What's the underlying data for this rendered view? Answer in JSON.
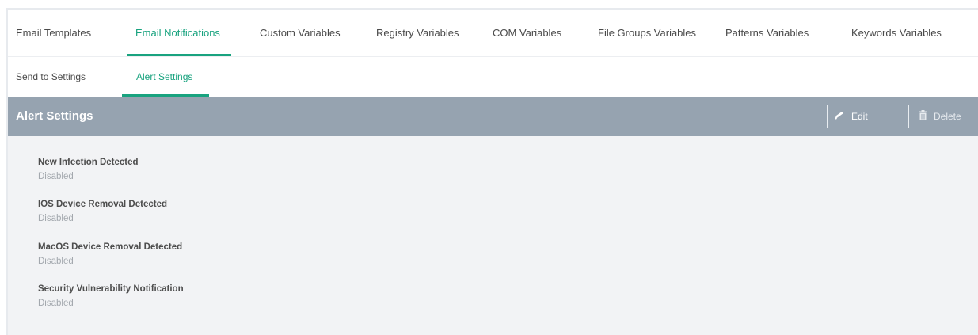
{
  "primary_tabs": [
    {
      "label": "Email Templates"
    },
    {
      "label": "Email Notifications"
    },
    {
      "label": "Custom Variables"
    },
    {
      "label": "Registry Variables"
    },
    {
      "label": "COM Variables"
    },
    {
      "label": "File Groups Variables"
    },
    {
      "label": "Patterns Variables"
    },
    {
      "label": "Keywords Variables"
    }
  ],
  "primary_active": "Email Notifications",
  "secondary_tabs": [
    {
      "label": "Send to Settings"
    },
    {
      "label": "Alert Settings"
    }
  ],
  "secondary_active": "Alert Settings",
  "panel": {
    "title": "Alert Settings",
    "edit_label": "Edit",
    "delete_label": "Delete"
  },
  "settings": [
    {
      "label": "New Infection Detected",
      "value": "Disabled"
    },
    {
      "label": "IOS Device Removal Detected",
      "value": "Disabled"
    },
    {
      "label": "MacOS Device Removal Detected",
      "value": "Disabled"
    },
    {
      "label": "Security Vulnerability Notification",
      "value": "Disabled"
    }
  ],
  "colors": {
    "accent": "#19a37f",
    "header_bg": "#96a3b0",
    "body_bg": "#f2f3f5"
  },
  "icons": {
    "edit": "pencil-icon",
    "delete": "trash-icon"
  }
}
